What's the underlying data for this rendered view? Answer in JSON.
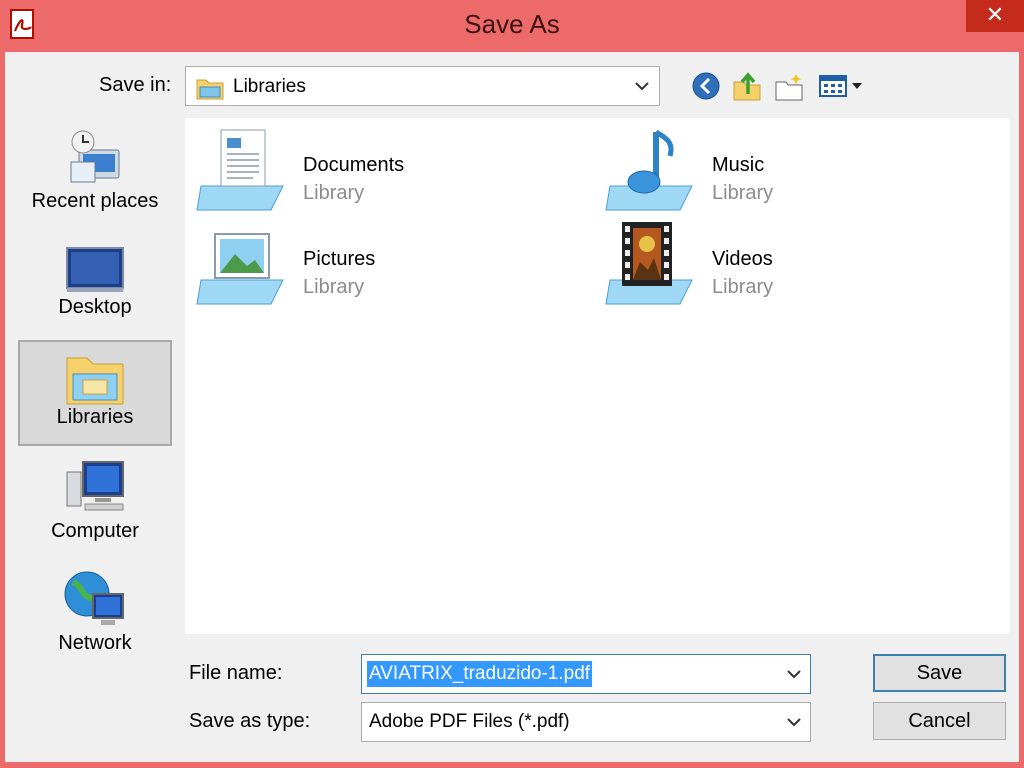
{
  "window": {
    "title": "Save As",
    "close_glyph": "✕",
    "app_icon": "pdf-icon"
  },
  "toolbar": {
    "save_in_label": "Save in:",
    "save_in_value": "Libraries",
    "buttons": [
      "back-icon",
      "up-folder-icon",
      "new-folder-icon",
      "view-menu-icon"
    ]
  },
  "places": [
    {
      "label": "Recent places",
      "icon": "recent-places-icon"
    },
    {
      "label": "Desktop",
      "icon": "desktop-icon"
    },
    {
      "label": "Libraries",
      "icon": "libraries-icon",
      "selected": true
    },
    {
      "label": "Computer",
      "icon": "computer-icon"
    },
    {
      "label": "Network",
      "icon": "network-icon"
    }
  ],
  "libraries": [
    {
      "name": "Documents",
      "type": "Library",
      "icon": "documents-library-icon"
    },
    {
      "name": "Music",
      "type": "Library",
      "icon": "music-library-icon"
    },
    {
      "name": "Pictures",
      "type": "Library",
      "icon": "pictures-library-icon"
    },
    {
      "name": "Videos",
      "type": "Library",
      "icon": "videos-library-icon"
    }
  ],
  "form": {
    "file_name_label": "File name:",
    "file_name_value": "AVIATRIX_traduzido-1.pdf",
    "save_type_label": "Save as type:",
    "save_type_value": "Adobe PDF Files (*.pdf)",
    "save_button": "Save",
    "cancel_button": "Cancel"
  },
  "colors": {
    "title_bar": "#ec6a6a",
    "selection": "#3399ff",
    "close_button": "#c42b1c"
  }
}
